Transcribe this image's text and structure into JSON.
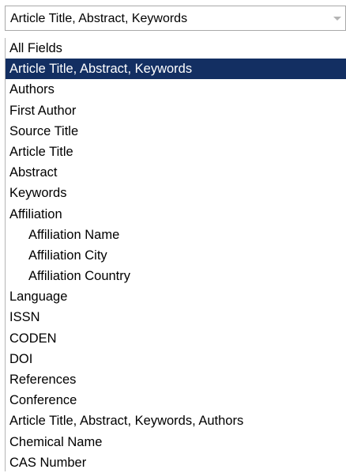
{
  "select": {
    "value": "Article Title, Abstract, Keywords",
    "arrow_icon": "chevron-down-icon"
  },
  "dropdown": {
    "selected_color": "#132f62",
    "options": [
      {
        "label": "All Fields",
        "indent": false,
        "selected": false
      },
      {
        "label": "Article Title, Abstract, Keywords",
        "indent": false,
        "selected": true
      },
      {
        "label": "Authors",
        "indent": false,
        "selected": false
      },
      {
        "label": "First Author",
        "indent": false,
        "selected": false
      },
      {
        "label": "Source Title",
        "indent": false,
        "selected": false
      },
      {
        "label": "Article Title",
        "indent": false,
        "selected": false
      },
      {
        "label": "Abstract",
        "indent": false,
        "selected": false
      },
      {
        "label": "Keywords",
        "indent": false,
        "selected": false
      },
      {
        "label": "Affiliation",
        "indent": false,
        "selected": false
      },
      {
        "label": "Affiliation Name",
        "indent": true,
        "selected": false
      },
      {
        "label": "Affiliation City",
        "indent": true,
        "selected": false
      },
      {
        "label": "Affiliation Country",
        "indent": true,
        "selected": false
      },
      {
        "label": "Language",
        "indent": false,
        "selected": false
      },
      {
        "label": "ISSN",
        "indent": false,
        "selected": false
      },
      {
        "label": "CODEN",
        "indent": false,
        "selected": false
      },
      {
        "label": "DOI",
        "indent": false,
        "selected": false
      },
      {
        "label": "References",
        "indent": false,
        "selected": false
      },
      {
        "label": "Conference",
        "indent": false,
        "selected": false
      },
      {
        "label": "Article Title, Abstract, Keywords, Authors",
        "indent": false,
        "selected": false
      },
      {
        "label": "Chemical Name",
        "indent": false,
        "selected": false
      },
      {
        "label": "CAS Number",
        "indent": false,
        "selected": false
      }
    ]
  }
}
